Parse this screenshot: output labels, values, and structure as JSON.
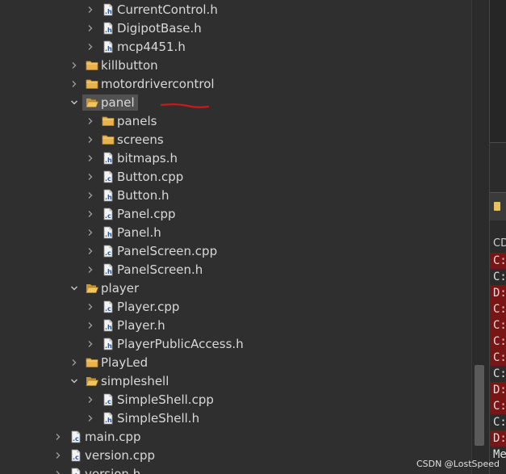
{
  "tree": [
    {
      "label": "CurrentControl.h",
      "kind": "h",
      "depth": 2,
      "expanded": false
    },
    {
      "label": "DigipotBase.h",
      "kind": "h",
      "depth": 2,
      "expanded": false
    },
    {
      "label": "mcp4451.h",
      "kind": "h",
      "depth": 2,
      "expanded": false
    },
    {
      "label": "killbutton",
      "kind": "folder",
      "depth": 1,
      "expanded": false
    },
    {
      "label": "motordrivercontrol",
      "kind": "folder",
      "depth": 1,
      "expanded": false
    },
    {
      "label": "panel",
      "kind": "folder-open",
      "depth": 1,
      "expanded": true,
      "selected": true
    },
    {
      "label": "panels",
      "kind": "folder",
      "depth": 2,
      "expanded": false
    },
    {
      "label": "screens",
      "kind": "folder",
      "depth": 2,
      "expanded": false
    },
    {
      "label": "bitmaps.h",
      "kind": "h",
      "depth": 2,
      "expanded": false
    },
    {
      "label": "Button.cpp",
      "kind": "c",
      "depth": 2,
      "expanded": false
    },
    {
      "label": "Button.h",
      "kind": "h",
      "depth": 2,
      "expanded": false
    },
    {
      "label": "Panel.cpp",
      "kind": "c",
      "depth": 2,
      "expanded": false
    },
    {
      "label": "Panel.h",
      "kind": "h",
      "depth": 2,
      "expanded": false
    },
    {
      "label": "PanelScreen.cpp",
      "kind": "c",
      "depth": 2,
      "expanded": false
    },
    {
      "label": "PanelScreen.h",
      "kind": "h",
      "depth": 2,
      "expanded": false
    },
    {
      "label": "player",
      "kind": "folder-open",
      "depth": 1,
      "expanded": true
    },
    {
      "label": "Player.cpp",
      "kind": "c",
      "depth": 2,
      "expanded": false
    },
    {
      "label": "Player.h",
      "kind": "h",
      "depth": 2,
      "expanded": false
    },
    {
      "label": "PlayerPublicAccess.h",
      "kind": "h",
      "depth": 2,
      "expanded": false
    },
    {
      "label": "PlayLed",
      "kind": "folder",
      "depth": 1,
      "expanded": false
    },
    {
      "label": "simpleshell",
      "kind": "folder-open",
      "depth": 1,
      "expanded": true
    },
    {
      "label": "SimpleShell.cpp",
      "kind": "c",
      "depth": 2,
      "expanded": false
    },
    {
      "label": "SimpleShell.h",
      "kind": "h",
      "depth": 2,
      "expanded": false
    },
    {
      "label": "main.cpp",
      "kind": "c",
      "depth": 0,
      "expanded": false
    },
    {
      "label": "version.cpp",
      "kind": "c",
      "depth": 0,
      "expanded": false
    },
    {
      "label": "version.h",
      "kind": "h",
      "depth": 0,
      "expanded": false
    }
  ],
  "console": {
    "header": "CD",
    "lines": [
      {
        "text": "C:",
        "error": true
      },
      {
        "text": "C:",
        "error": false
      },
      {
        "text": "D:",
        "error": true
      },
      {
        "text": "C:",
        "error": true
      },
      {
        "text": "C:",
        "error": true
      },
      {
        "text": "C:",
        "error": true
      },
      {
        "text": "C:",
        "error": true
      },
      {
        "text": "C:",
        "error": false
      },
      {
        "text": "D:",
        "error": true
      },
      {
        "text": "C:",
        "error": true
      },
      {
        "text": "C:",
        "error": false
      },
      {
        "text": "D:",
        "error": true
      },
      {
        "text": "Me",
        "error": false
      }
    ]
  },
  "watermark": "CSDN @LostSpeed",
  "colors": {
    "background": "#2f2f2f",
    "text": "#d8d8d8",
    "selection": "#515151",
    "folder": "#e8b34a",
    "error_line": "#7a1515",
    "annotation": "#d01818"
  }
}
